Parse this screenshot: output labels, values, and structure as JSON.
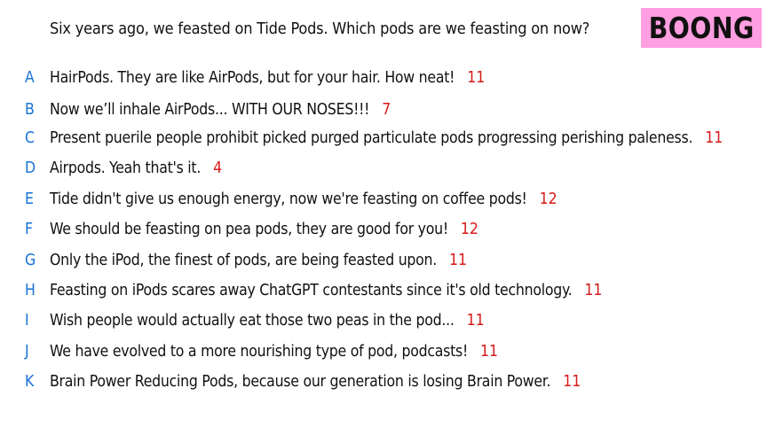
{
  "prompt": "Six years ago, we feasted on Tide Pods. Which pods are we feasting on now?",
  "brand": {
    "label": "BOONG",
    "background": "#ff9ee0"
  },
  "colors": {
    "letter": "#1773d6",
    "score": "#d61a1a",
    "text": "#111111"
  },
  "answers": [
    {
      "letter": "A",
      "text": "HairPods. They are like AirPods, but for your hair. How neat!",
      "score": "11"
    },
    {
      "letter": "B",
      "text": "Now we’ll inhale AirPods... WITH OUR NOSES!!!",
      "score": "7"
    },
    {
      "letter": "C",
      "text": "Present puerile people prohibit picked purged particulate pods progressing perishing paleness.",
      "score": "11"
    },
    {
      "letter": "D",
      "text": "Airpods. Yeah that's it.",
      "score": "4"
    },
    {
      "letter": "E",
      "text": "Tide didn't give us enough energy, now we're feasting on coffee pods!",
      "score": "12"
    },
    {
      "letter": "F",
      "text": "We should be feasting on pea pods, they are good for you!",
      "score": "12"
    },
    {
      "letter": "G",
      "text": "Only the iPod, the finest of pods, are being feasted upon.",
      "score": "11"
    },
    {
      "letter": "H",
      "text": "Feasting on iPods scares away ChatGPT contestants since it's old technology.",
      "score": "11"
    },
    {
      "letter": "I",
      "text": "Wish people would actually eat those two peas in the pod...",
      "score": "11"
    },
    {
      "letter": "J",
      "text": "We have evolved to a more nourishing type of pod, podcasts!",
      "score": "11"
    },
    {
      "letter": "K",
      "text": "Brain Power Reducing Pods, because our generation is losing Brain Power.",
      "score": "11"
    }
  ]
}
